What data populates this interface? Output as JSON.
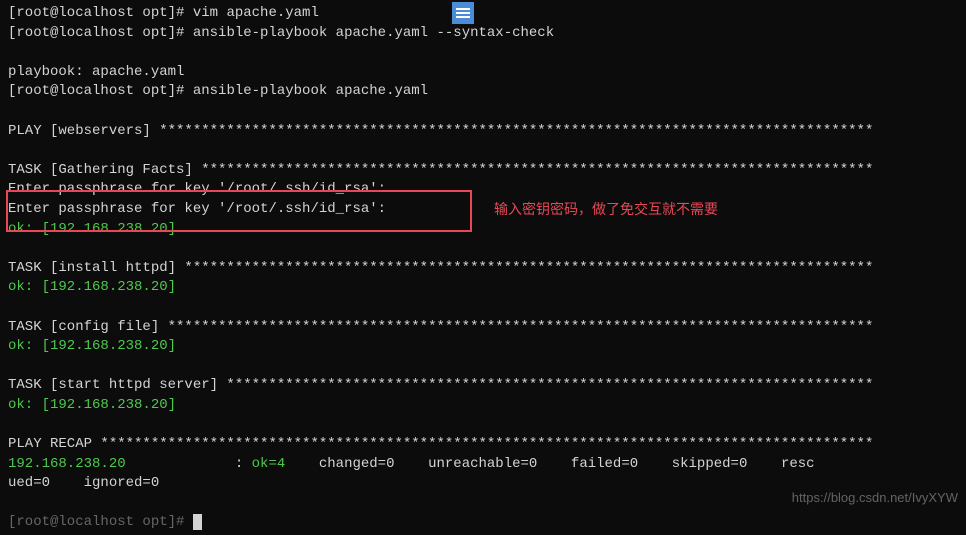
{
  "lines": {
    "l1_prompt": "[root@localhost opt]# ",
    "l1_cmd": "vim apache.yaml",
    "l2_prompt": "[root@localhost opt]# ",
    "l2_cmd": "ansible-playbook apache.yaml --syntax-check",
    "l3": "playbook: apache.yaml",
    "l4_prompt": "[root@localhost opt]# ",
    "l4_cmd": "ansible-playbook apache.yaml",
    "play_header": "PLAY [webservers] *************************************************************************************",
    "task_gathering": "TASK [Gathering Facts] ********************************************************************************",
    "passphrase1": "Enter passphrase for key '/root/.ssh/id_rsa':",
    "passphrase2": "Enter passphrase for key '/root/.ssh/id_rsa':",
    "ok1": "ok: [192.168.238.20]",
    "task_install": "TASK [install httpd] **********************************************************************************",
    "ok2": "ok: [192.168.238.20]",
    "task_config": "TASK [config file] ************************************************************************************",
    "ok3": "ok: [192.168.238.20]",
    "task_start": "TASK [start httpd server] *****************************************************************************",
    "ok4": "ok: [192.168.238.20]",
    "recap_header": "PLAY RECAP ********************************************************************************************",
    "recap_host": "192.168.238.20",
    "recap_stats": "             : ",
    "recap_ok": "ok=4   ",
    "recap_rest": " changed=0    unreachable=0    failed=0    skipped=0    resc",
    "recap_line2": "ued=0    ignored=0",
    "last_prompt": "[root@localhost opt]# "
  },
  "annotation": "输入密钥密码，做了免交互就不需要",
  "watermark": "https://blog.csdn.net/IvyXYW"
}
